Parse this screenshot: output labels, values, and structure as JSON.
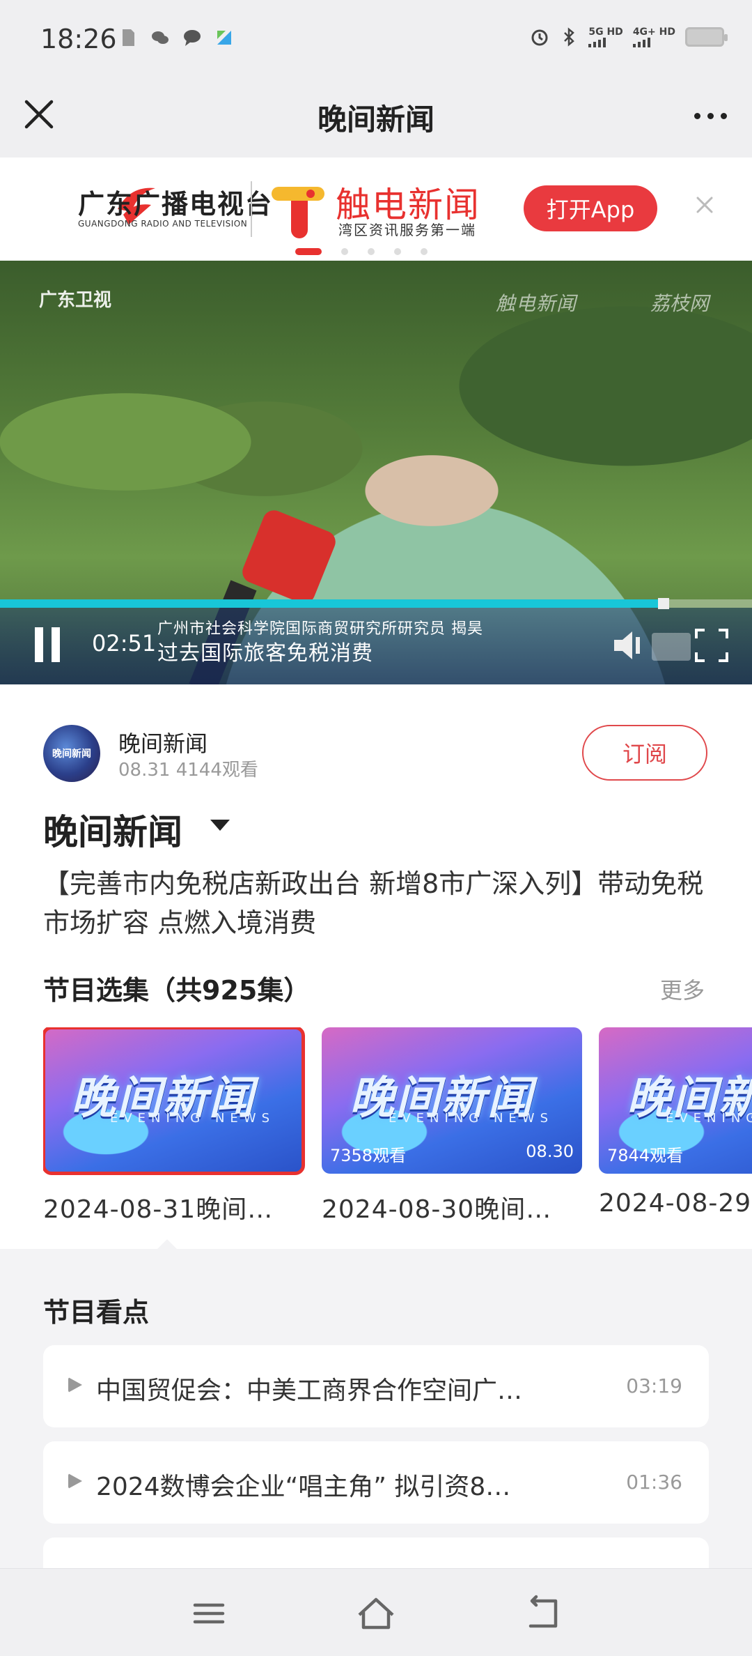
{
  "status_bar": {
    "time": "18:26",
    "net1": "5G HD",
    "net2": "4G+ HD"
  },
  "title_bar": {
    "title": "晚间新闻"
  },
  "banner": {
    "broadcaster_name": "广东广播电视台",
    "broadcaster_en": "GUANGDONG RADIO AND TELEVISION",
    "app_name": "触电新闻",
    "app_slogan": "湾区资讯服务第一端",
    "open_app_label": "打开App"
  },
  "video": {
    "channel_logo": "广东卫视",
    "watermark_1": "触电新闻",
    "watermark_2": "荔枝网",
    "lower_third_title": "广州市社会科学院国际商贸研究所研究员  揭昊",
    "lower_third_caption": "过去国际旅客免税消费",
    "elapsed_time": "02:51",
    "progress": 0.875
  },
  "channel": {
    "avatar_text": "晚间新闻",
    "name": "晚间新闻",
    "meta": "08.31 4144观看",
    "subscribe_label": "订阅"
  },
  "program": {
    "title": "晚间新闻",
    "summary": "【完善市内免税店新政出台 新增8市广深入列】带动免税市场扩容 点燃入境消费"
  },
  "episodes_section": {
    "header": "节目选集（共925集）",
    "more_label": "更多",
    "items": [
      {
        "thumb_title": "晚间新闻",
        "thumb_sub": "EVENING NEWS",
        "views": "",
        "date": "",
        "title": "2024-08-31晚间…"
      },
      {
        "thumb_title": "晚间新闻",
        "thumb_sub": "EVENING NEWS",
        "views": "7358观看",
        "date": "08.30",
        "title": "2024-08-30晚间…"
      },
      {
        "thumb_title": "晚间新闻",
        "thumb_sub": "EVENING NEWS",
        "views": "7844观看",
        "date": "",
        "title": "2024-08-29"
      }
    ]
  },
  "highlights": {
    "header": "节目看点",
    "items": [
      {
        "title": "中国贸促会：中美工商界合作空间广…",
        "duration": "03:19"
      },
      {
        "title": "2024数博会企业“唱主角” 拟引资8…",
        "duration": "01:36"
      },
      {
        "title": "",
        "duration": ""
      }
    ]
  },
  "colors": {
    "accent": "#e8312f",
    "progress": "#18c6d8"
  }
}
